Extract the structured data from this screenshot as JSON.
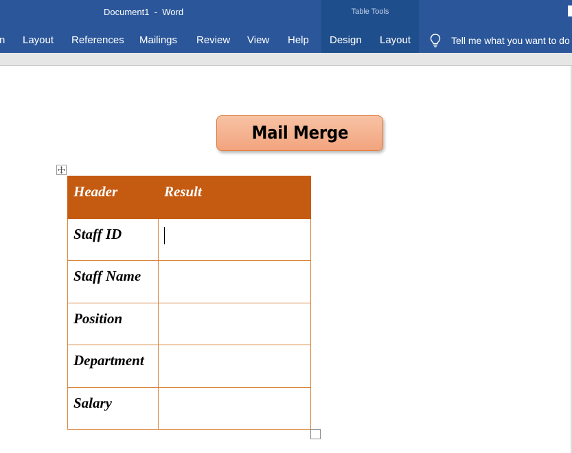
{
  "titlebar": {
    "document_title": "Document1  -  Word",
    "contextual_group": "Table Tools"
  },
  "ribbon": {
    "tabs": [
      {
        "label": "n"
      },
      {
        "label": "Layout"
      },
      {
        "label": "References"
      },
      {
        "label": "Mailings"
      },
      {
        "label": "Review"
      },
      {
        "label": "View"
      },
      {
        "label": "Help"
      },
      {
        "label": "Design"
      },
      {
        "label": "Layout"
      }
    ],
    "tell_me": {
      "icon": "lightbulb-icon",
      "text": "Tell me what you want to do"
    }
  },
  "document": {
    "heading_shape": {
      "text": "Mail Merge"
    },
    "table": {
      "headers": [
        "Header",
        "Result"
      ],
      "rows": [
        [
          "Staff ID",
          ""
        ],
        [
          "Staff Name",
          ""
        ],
        [
          "Position",
          ""
        ],
        [
          "Department",
          ""
        ],
        [
          "Salary",
          ""
        ]
      ]
    }
  },
  "colors": {
    "ribbon_blue": "#2b579a",
    "contextual_blue": "#1f4e8c",
    "table_header": "#c55a11",
    "table_border": "#d9853b",
    "shape_fill": "#f4b08c"
  }
}
